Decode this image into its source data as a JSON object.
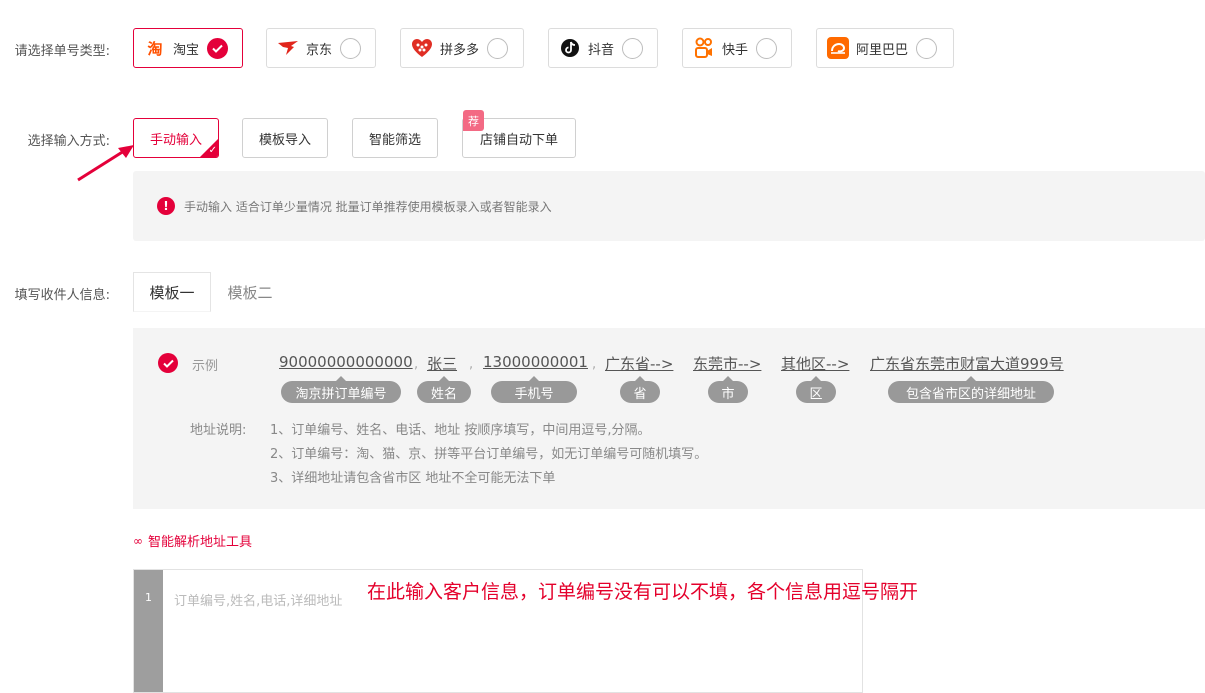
{
  "order_type": {
    "label": "请选择单号类型:",
    "platforms": [
      {
        "name": "淘宝",
        "icon": "taobao-icon",
        "color": "#ff5000",
        "selected": true
      },
      {
        "name": "京东",
        "icon": "jd-icon",
        "color": "#e1251b",
        "selected": false
      },
      {
        "name": "拼多多",
        "icon": "pinduoduo-icon",
        "color": "#e02e24",
        "selected": false
      },
      {
        "name": "抖音",
        "icon": "douyin-icon",
        "color": "#111111",
        "selected": false
      },
      {
        "name": "快手",
        "icon": "kuaishou-icon",
        "color": "#ff7200",
        "selected": false
      },
      {
        "name": "阿里巴巴",
        "icon": "alibaba-icon",
        "color": "#ff6a00",
        "selected": false
      }
    ]
  },
  "input_mode": {
    "label": "选择输入方式:",
    "modes": [
      {
        "name": "手动输入",
        "selected": true
      },
      {
        "name": "模板导入",
        "selected": false
      },
      {
        "name": "智能筛选",
        "selected": false
      },
      {
        "name": "店铺自动下单",
        "selected": false,
        "badge": "荐"
      }
    ]
  },
  "notice": {
    "text": "手动输入 适合订单少量情况 批量订单推荐使用模板录入或者智能录入"
  },
  "receiver": {
    "label": "填写收件人信息:",
    "tabs": [
      "模板一",
      "模板二"
    ],
    "active_tab": 0
  },
  "example": {
    "label": "示例",
    "separator": ",",
    "fields": [
      {
        "value": "90000000000000",
        "tag": "淘京拼订单编号"
      },
      {
        "value": "张三",
        "tag": "姓名"
      },
      {
        "value": "13000000001",
        "tag": "手机号"
      },
      {
        "value": "广东省-->",
        "tag": "省"
      },
      {
        "value": "东莞市-->",
        "tag": "市"
      },
      {
        "value": "其他区-->",
        "tag": "区"
      },
      {
        "value": "广东省东莞市财富大道999号",
        "tag": "包含省市区的详细地址"
      }
    ],
    "address_title": "地址说明:",
    "address_notes": [
      "1、订单编号、姓名、电话、地址 按顺序填写，中间用逗号,分隔。",
      "2、订单编号：淘、猫、京、拼等平台订单编号，如无订单编号可随机填写。",
      "3、详细地址请包含省市区 地址不全可能无法下单"
    ]
  },
  "parse_tool": {
    "label": "智能解析地址工具",
    "icon": "link-icon"
  },
  "editor": {
    "line_number": "1",
    "placeholder": "订单编号,姓名,电话,详细地址"
  },
  "annotation": {
    "text": "在此输入客户信息，订单编号没有可以不填，各个信息用逗号隔开"
  },
  "colors": {
    "accent": "#e4003a",
    "tag_bg": "#999999",
    "panel_bg": "#f4f4f4"
  }
}
